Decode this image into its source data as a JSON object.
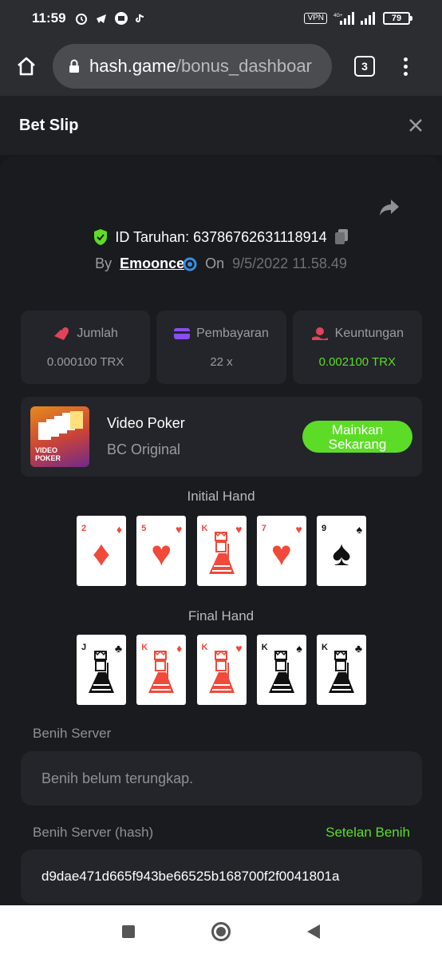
{
  "status_bar": {
    "time": "11:59",
    "vpn": "VPN",
    "network": "4G+",
    "battery": "79"
  },
  "browser": {
    "url_domain": "hash.game",
    "url_path": "/bonus_dashboar",
    "tab_count": "3"
  },
  "slip": {
    "title": "Bet Slip",
    "bet_id_label": "ID Taruhan: 63786762631118914",
    "by_label": "By",
    "user": "Emoonce",
    "on_label": "On",
    "date": "9/5/2022 11.58.49"
  },
  "stats": [
    {
      "label": "Jumlah",
      "value": "0.000100 TRX",
      "icon": "coins-icon"
    },
    {
      "label": "Pembayaran",
      "value": "22 x",
      "icon": "card-icon"
    },
    {
      "label": "Keuntungan",
      "value": "0.002100 TRX",
      "icon": "profit-icon"
    }
  ],
  "game": {
    "title": "Video Poker",
    "subtitle": "BC Original",
    "thumb_text_1": "VIDEO",
    "thumb_text_2": "POKER",
    "play_line1": "Mainkan",
    "play_line2": "Sekarang"
  },
  "initial_hand": {
    "title": "Initial Hand",
    "cards": [
      {
        "rank": "2",
        "suit": "♦",
        "color": "red",
        "type": "pip"
      },
      {
        "rank": "5",
        "suit": "♥",
        "color": "red",
        "type": "pip"
      },
      {
        "rank": "K",
        "suit": "♥",
        "color": "red",
        "type": "face"
      },
      {
        "rank": "7",
        "suit": "♥",
        "color": "red",
        "type": "pip"
      },
      {
        "rank": "9",
        "suit": "♠",
        "color": "black",
        "type": "pip"
      }
    ]
  },
  "final_hand": {
    "title": "Final Hand",
    "cards": [
      {
        "rank": "J",
        "suit": "♣",
        "color": "black",
        "type": "face"
      },
      {
        "rank": "K",
        "suit": "♦",
        "color": "red",
        "type": "face"
      },
      {
        "rank": "K",
        "suit": "♥",
        "color": "red",
        "type": "face"
      },
      {
        "rank": "K",
        "suit": "♠",
        "color": "black",
        "type": "face"
      },
      {
        "rank": "K",
        "suit": "♣",
        "color": "black",
        "type": "face"
      }
    ]
  },
  "seeds": {
    "server_label": "Benih Server",
    "server_placeholder": "Benih belum terungkap.",
    "hash_label": "Benih Server (hash)",
    "settings_link": "Setelan Benih",
    "hash_value": "d9dae471d665f943be66525b168700f2f0041801a"
  },
  "colors": {
    "accent_green": "#5ddc27",
    "panel": "#23252a",
    "card_red": "#f1493a"
  }
}
